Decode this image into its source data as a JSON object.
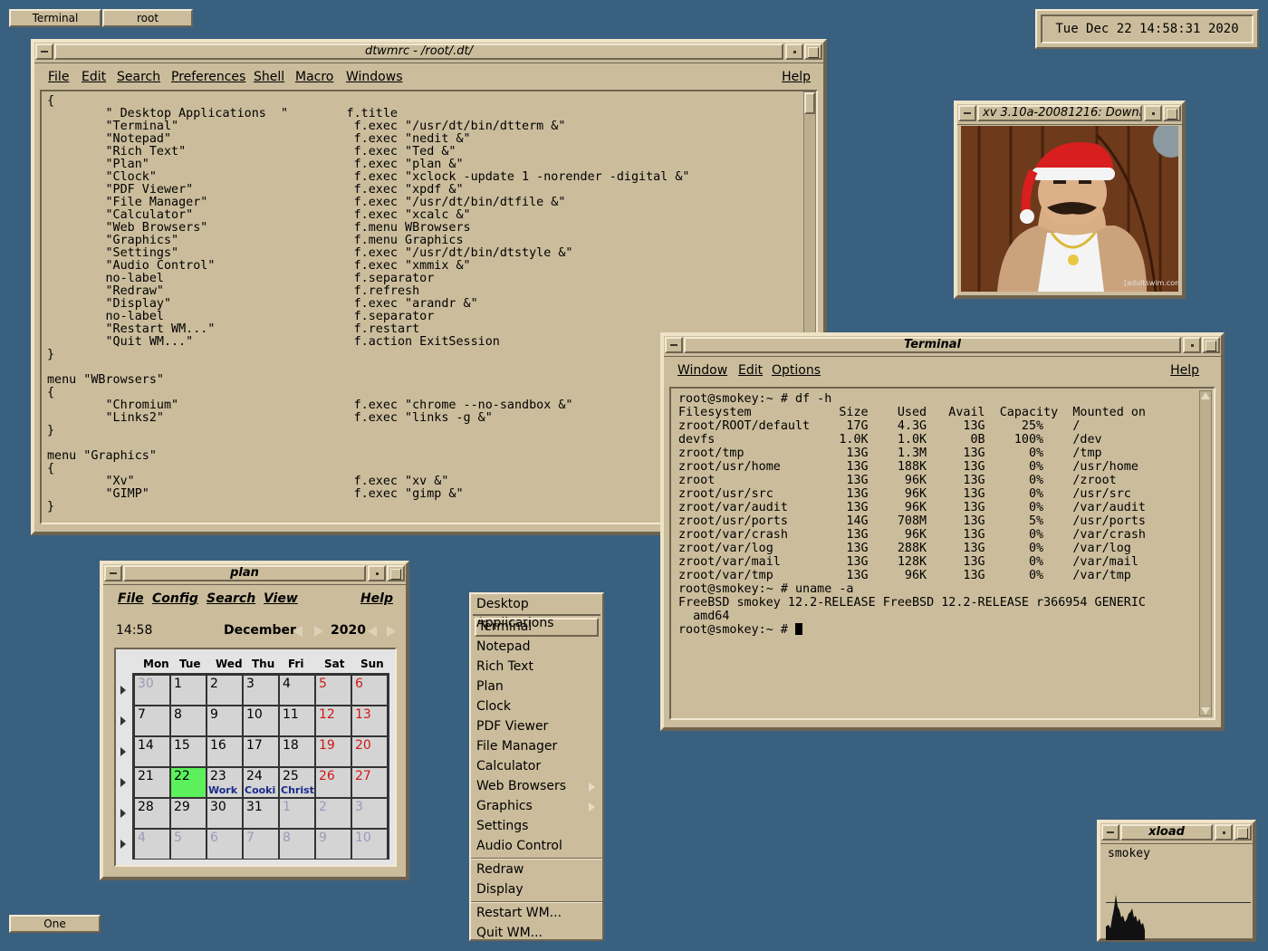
{
  "taskbar": {
    "terminal_label": "Terminal",
    "root_label": "root",
    "workspace_label": "One"
  },
  "clock": {
    "text": "Tue Dec 22 14:58:31 2020"
  },
  "editor": {
    "title": "dtwmrc - /root/.dt/",
    "menus": [
      "File",
      "Edit",
      "Search",
      "Preferences",
      "Shell",
      "Macro",
      "Windows"
    ],
    "help": "Help",
    "content": "{\n        \" Desktop Applications  \"        f.title\n        \"Terminal\"                        f.exec \"/usr/dt/bin/dtterm &\"\n        \"Notepad\"                         f.exec \"nedit &\"\n        \"Rich Text\"                       f.exec \"Ted &\"\n        \"Plan\"                            f.exec \"plan &\"\n        \"Clock\"                           f.exec \"xclock -update 1 -norender -digital &\"\n        \"PDF Viewer\"                      f.exec \"xpdf &\"\n        \"File Manager\"                    f.exec \"/usr/dt/bin/dtfile &\"\n        \"Calculator\"                      f.exec \"xcalc &\"\n        \"Web Browsers\"                    f.menu WBrowsers\n        \"Graphics\"                        f.menu Graphics\n        \"Settings\"                        f.exec \"/usr/dt/bin/dtstyle &\"\n        \"Audio Control\"                   f.exec \"xmmix &\"\n        no-label                          f.separator\n        \"Redraw\"                          f.refresh\n        \"Display\"                         f.exec \"arandr &\"\n        no-label                          f.separator\n        \"Restart WM...\"                   f.restart\n        \"Quit WM...\"                      f.action ExitSession\n}\n\nmenu \"WBrowsers\"\n{\n        \"Chromium\"                        f.exec \"chrome --no-sandbox &\"\n        \"Links2\"                          f.exec \"links -g &\"\n}\n\nmenu \"Graphics\"\n{\n        \"Xv\"                              f.exec \"xv &\"\n        \"GIMP\"                            f.exec \"gimp &\"\n}"
  },
  "xv": {
    "title": "xv 3.10a-20081216: Downl",
    "watermark": "[adultswim.com]"
  },
  "terminal": {
    "title": "Terminal",
    "menus": [
      "Window",
      "Edit",
      "Options"
    ],
    "help": "Help",
    "content": "root@smokey:~ # df -h\nFilesystem            Size    Used   Avail  Capacity  Mounted on\nzroot/ROOT/default     17G    4.3G     13G     25%    /\ndevfs                 1.0K    1.0K      0B    100%    /dev\nzroot/tmp              13G    1.3M     13G      0%    /tmp\nzroot/usr/home         13G    188K     13G      0%    /usr/home\nzroot                  13G     96K     13G      0%    /zroot\nzroot/usr/src          13G     96K     13G      0%    /usr/src\nzroot/var/audit        13G     96K     13G      0%    /var/audit\nzroot/usr/ports        14G    708M     13G      5%    /usr/ports\nzroot/var/crash        13G     96K     13G      0%    /var/crash\nzroot/var/log          13G    288K     13G      0%    /var/log\nzroot/var/mail         13G    128K     13G      0%    /var/mail\nzroot/var/tmp          13G     96K     13G      0%    /var/tmp\nroot@smokey:~ # uname -a\nFreeBSD smokey 12.2-RELEASE FreeBSD 12.2-RELEASE r366954 GENERIC\n  amd64\nroot@smokey:~ # "
  },
  "plan": {
    "title": "plan",
    "menus": [
      "File",
      "Config",
      "Search",
      "View"
    ],
    "help": "Help",
    "time": "14:58",
    "month": "December",
    "year": "2020",
    "weekdays": [
      "Mon",
      "Tue",
      "Wed",
      "Thu",
      "Fri",
      "Sat",
      "Sun"
    ],
    "weeks": [
      [
        {
          "d": "30",
          "other": true
        },
        {
          "d": "1"
        },
        {
          "d": "2"
        },
        {
          "d": "3"
        },
        {
          "d": "4"
        },
        {
          "d": "5",
          "we": true
        },
        {
          "d": "6",
          "we": true
        }
      ],
      [
        {
          "d": "7"
        },
        {
          "d": "8"
        },
        {
          "d": "9"
        },
        {
          "d": "10"
        },
        {
          "d": "11"
        },
        {
          "d": "12",
          "we": true
        },
        {
          "d": "13",
          "we": true
        }
      ],
      [
        {
          "d": "14"
        },
        {
          "d": "15"
        },
        {
          "d": "16"
        },
        {
          "d": "17"
        },
        {
          "d": "18"
        },
        {
          "d": "19",
          "we": true
        },
        {
          "d": "20",
          "we": true
        }
      ],
      [
        {
          "d": "21"
        },
        {
          "d": "22",
          "today": true
        },
        {
          "d": "23",
          "appt": "Work"
        },
        {
          "d": "24",
          "appt": "Cooki"
        },
        {
          "d": "25",
          "appt": "Christ"
        },
        {
          "d": "26",
          "we": true
        },
        {
          "d": "27",
          "we": true
        }
      ],
      [
        {
          "d": "28"
        },
        {
          "d": "29"
        },
        {
          "d": "30"
        },
        {
          "d": "31"
        },
        {
          "d": "1",
          "other": true
        },
        {
          "d": "2",
          "other": true
        },
        {
          "d": "3",
          "other": true
        }
      ],
      [
        {
          "d": "4",
          "other": true
        },
        {
          "d": "5",
          "other": true
        },
        {
          "d": "6",
          "other": true
        },
        {
          "d": "7",
          "other": true
        },
        {
          "d": "8",
          "other": true
        },
        {
          "d": "9",
          "other": true
        },
        {
          "d": "10",
          "other": true
        }
      ]
    ]
  },
  "root_menu": {
    "title": "Desktop Applications",
    "groups": [
      [
        "Terminal",
        "Notepad",
        "Rich Text",
        "Plan",
        "Clock",
        "PDF Viewer",
        "File Manager",
        "Calculator",
        "Web Browsers",
        "Graphics",
        "Settings",
        "Audio Control"
      ],
      [
        "Redraw",
        "Display"
      ],
      [
        "Restart WM...",
        "Quit WM..."
      ]
    ],
    "selected": "Terminal",
    "submenus": [
      "Web Browsers",
      "Graphics"
    ]
  },
  "xload": {
    "title": "xload",
    "host": "smokey"
  },
  "colors": {
    "desktop": "#3a6080",
    "panel": "#cbbd9c",
    "today": "#5cf05c",
    "weekend": "#d01818"
  }
}
